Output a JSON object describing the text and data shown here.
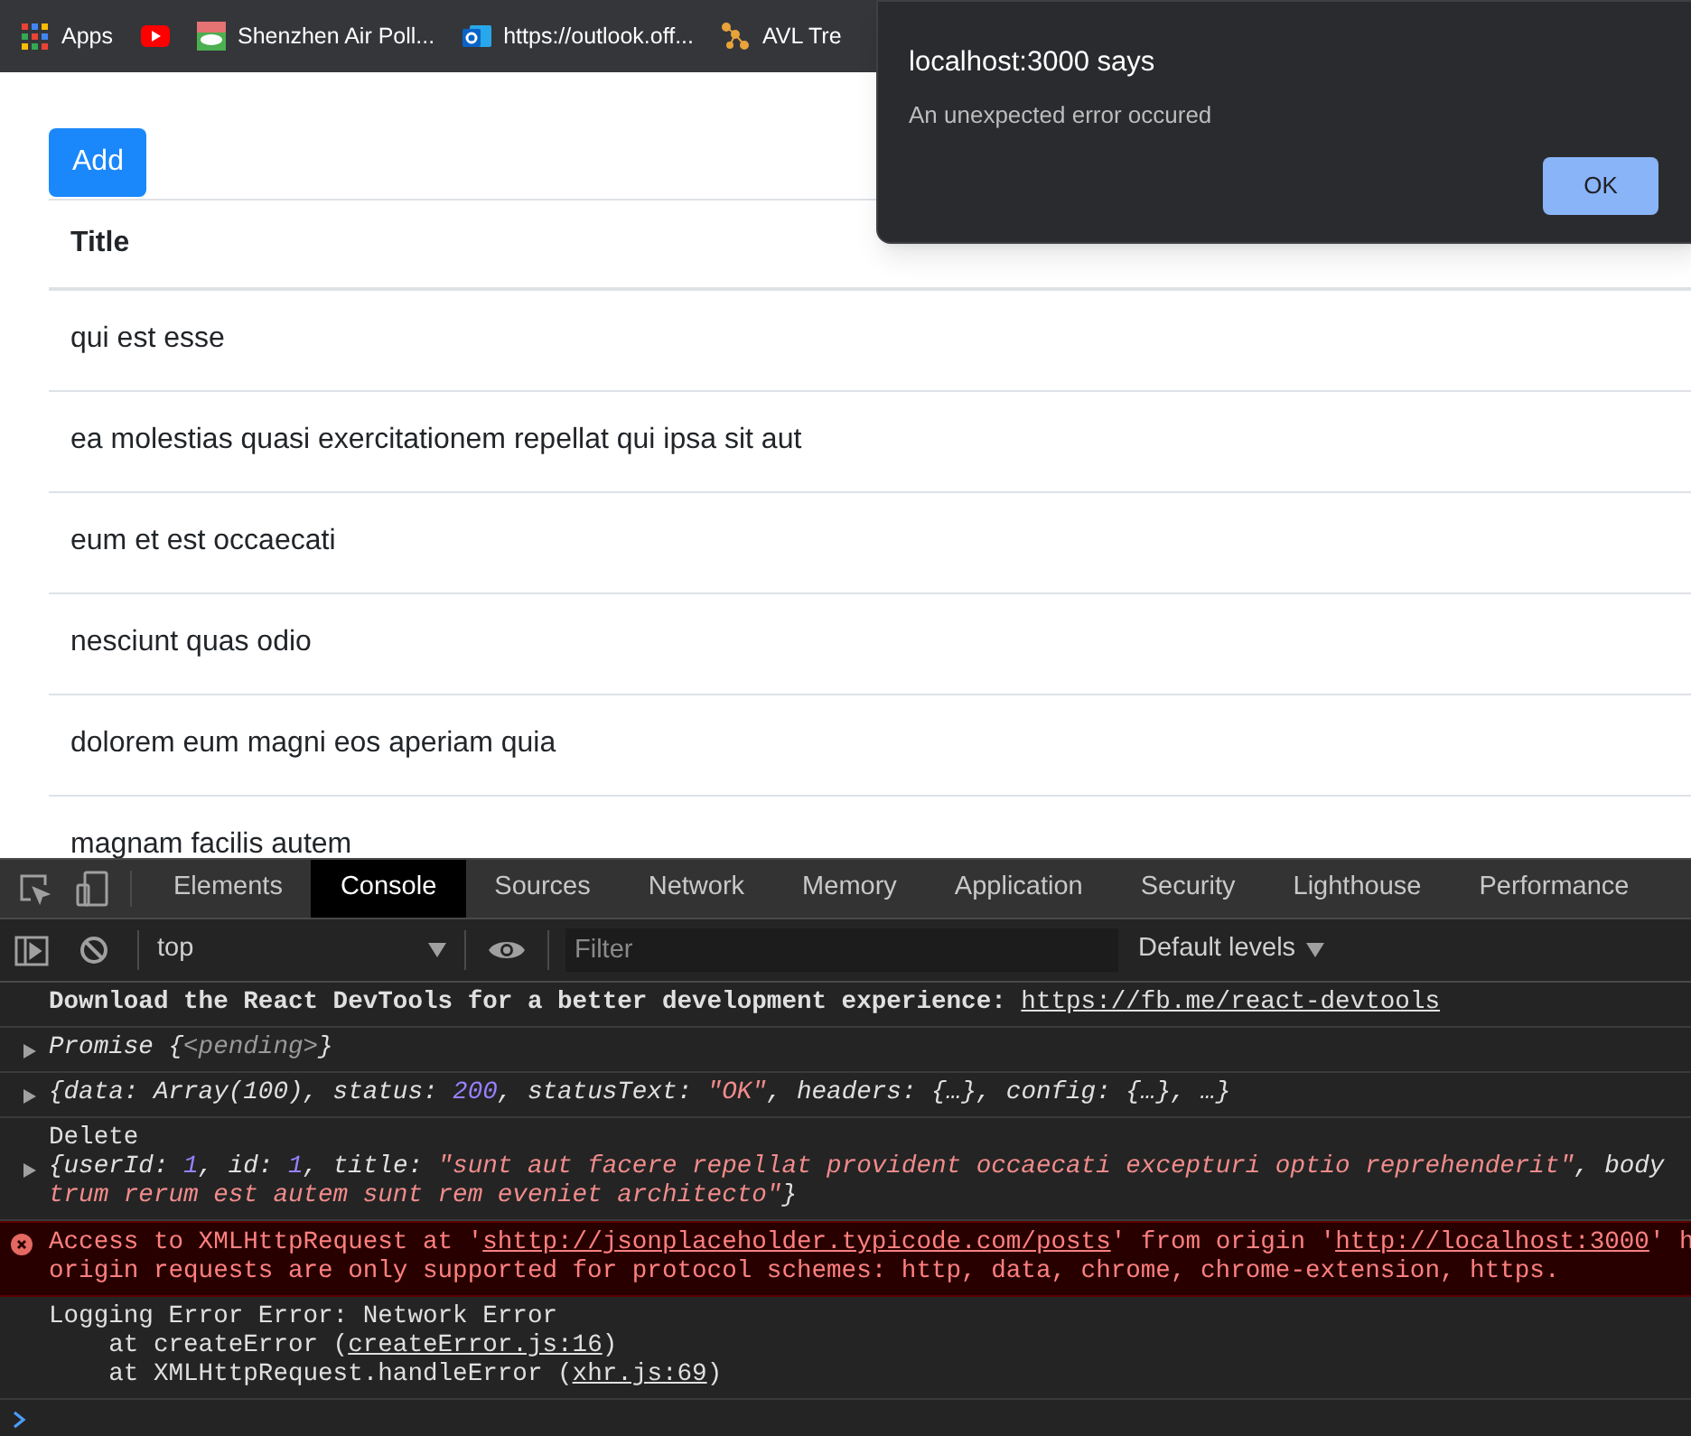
{
  "bookmarks": [
    {
      "kind": "apps",
      "label": "Apps"
    },
    {
      "kind": "video"
    },
    {
      "kind": "image",
      "label": "Shenzhen Air Poll..."
    },
    {
      "kind": "mail",
      "label": "https://outlook.off..."
    },
    {
      "kind": "graph",
      "label": "AVL Tre"
    }
  ],
  "dialog": {
    "title": "localhost:3000 says",
    "message": "An unexpected error occured",
    "button": "OK"
  },
  "page": {
    "add_button": "Add",
    "table": {
      "columns": [
        "Title"
      ],
      "rows": [
        "qui est esse",
        "ea molestias quasi exercitationem repellat qui ipsa sit aut",
        "eum et est occaecati",
        "nesciunt quas odio",
        "dolorem eum magni eos aperiam quia",
        "magnam facilis autem"
      ]
    }
  },
  "devtools": {
    "tabs": [
      {
        "label": "Elements",
        "selected": false
      },
      {
        "label": "Console",
        "selected": true
      },
      {
        "label": "Sources",
        "selected": false
      },
      {
        "label": "Network",
        "selected": false
      },
      {
        "label": "Memory",
        "selected": false
      },
      {
        "label": "Application",
        "selected": false
      },
      {
        "label": "Security",
        "selected": false
      },
      {
        "label": "Lighthouse",
        "selected": false
      },
      {
        "label": "Performance",
        "selected": false
      }
    ],
    "context": "top",
    "filter": {
      "placeholder": "Filter"
    },
    "levels": "Default levels",
    "messages": [
      {
        "kind": "log",
        "lines": [
          [
            {
              "kind": "bold",
              "text": "Download the React DevTools for a better development experience: "
            },
            {
              "kind": "link",
              "text": "https://fb.me/react-devtools"
            }
          ]
        ]
      },
      {
        "kind": "object",
        "expanded": false,
        "lines": [
          [
            {
              "kind": "italic",
              "text": "Promise {"
            },
            {
              "kind": "dim",
              "text": "<pending>"
            },
            {
              "kind": "italic",
              "text": "}"
            }
          ]
        ]
      },
      {
        "kind": "object",
        "expanded": false,
        "lines": [
          [
            {
              "kind": "italic",
              "text": "{data: Array(100), status: "
            },
            {
              "kind": "number",
              "text": "200"
            },
            {
              "kind": "italic",
              "text": ", statusText: "
            },
            {
              "kind": "string",
              "text": "\"OK\""
            },
            {
              "kind": "italic",
              "text": ", headers: {…}, config: {…}, …}"
            }
          ]
        ]
      },
      {
        "kind": "object",
        "label": "Delete",
        "expanded": false,
        "lines": [
          [
            {
              "kind": "italic",
              "text": "{userId: "
            },
            {
              "kind": "number",
              "text": "1"
            },
            {
              "kind": "italic",
              "text": ", id: "
            },
            {
              "kind": "number",
              "text": "1"
            },
            {
              "kind": "italic",
              "text": ", title: "
            },
            {
              "kind": "string",
              "text": "\"sunt aut facere repellat provident occaecati excepturi optio reprehenderit\""
            },
            {
              "kind": "italic",
              "text": ", body"
            }
          ],
          [
            {
              "kind": "string",
              "text": "trum rerum est autem sunt rem eveniet architecto\""
            },
            {
              "kind": "italic",
              "text": "}"
            }
          ]
        ]
      },
      {
        "kind": "error",
        "lines": [
          [
            {
              "kind": "plain",
              "text": "Access to XMLHttpRequest at '"
            },
            {
              "kind": "link",
              "text": "shttp://jsonplaceholder.typicode.com/posts"
            },
            {
              "kind": "plain",
              "text": "' from origin '"
            },
            {
              "kind": "link",
              "text": "http://localhost:3000"
            },
            {
              "kind": "plain",
              "text": "' h"
            }
          ],
          [
            {
              "kind": "plain",
              "text": "origin requests are only supported for protocol schemes: http, data, chrome, chrome-extension, https."
            }
          ]
        ]
      },
      {
        "kind": "log",
        "lines": [
          [
            {
              "kind": "plain",
              "text": "Logging Error Error: Network Error"
            }
          ],
          [
            {
              "kind": "plain",
              "text": "    at createError ("
            },
            {
              "kind": "link",
              "text": "createError.js:16"
            },
            {
              "kind": "plain",
              "text": ")"
            }
          ],
          [
            {
              "kind": "plain",
              "text": "    at XMLHttpRequest.handleError ("
            },
            {
              "kind": "link",
              "text": "xhr.js:69"
            },
            {
              "kind": "plain",
              "text": ")"
            }
          ]
        ]
      }
    ]
  }
}
